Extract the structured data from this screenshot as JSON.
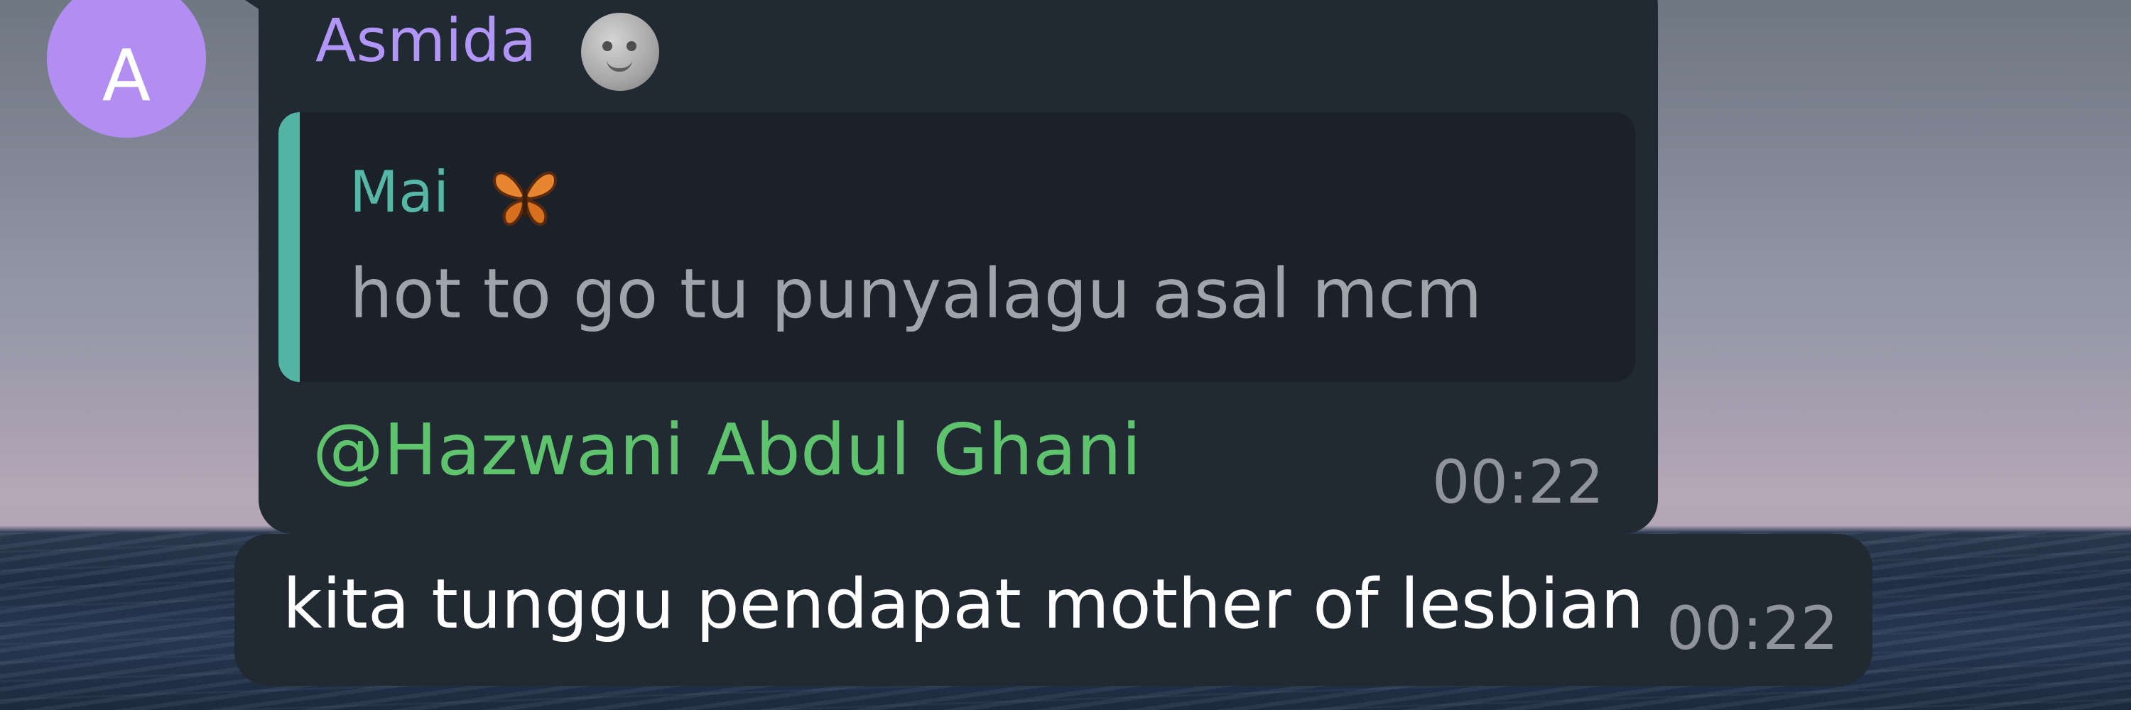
{
  "message_1": {
    "avatar_letter": "A",
    "sender": "Asmida",
    "sender_emoji": "full-moon-face-icon",
    "reply": {
      "author": "Mai",
      "author_emoji": "butterfly-icon",
      "text": "hot to go tu punyalagu asal mcm"
    },
    "mention": "@Hazwani Abdul Ghani",
    "time": "00:22"
  },
  "message_2": {
    "text": "kita tunggu pendapat mother of lesbian",
    "time": "00:22"
  },
  "colors": {
    "bubble": "#212a33",
    "sender": "#b196f8",
    "avatar": "#b28ef3",
    "reply_accent": "#52b5a4",
    "mention": "#5fc36d",
    "timestamp": "#8e949a"
  }
}
